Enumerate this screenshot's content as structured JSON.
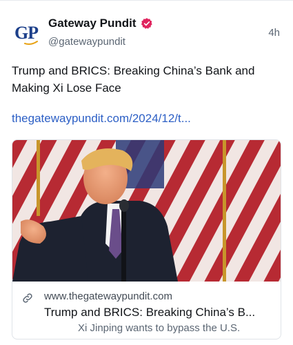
{
  "post": {
    "avatar_text": "GP",
    "display_name": "Gateway Pundit",
    "handle": "@gatewaypundit",
    "timestamp": "4h",
    "text": "Trump and BRICS: Breaking China’s Bank and Making Xi Lose Face",
    "link": "thegatewaypundit.com/2024/12/t..."
  },
  "card": {
    "domain": "www.thegatewaypundit.com",
    "title": "Trump and BRICS: Breaking China’s B...",
    "description": "Xi Jinping wants to bypass the U.S."
  },
  "colors": {
    "brand_blue": "#1c3f8a",
    "verified_badge": "#e0245e",
    "link": "#2c5fc5"
  },
  "icons": {
    "verified": "verified-badge-icon",
    "link": "link-icon"
  }
}
